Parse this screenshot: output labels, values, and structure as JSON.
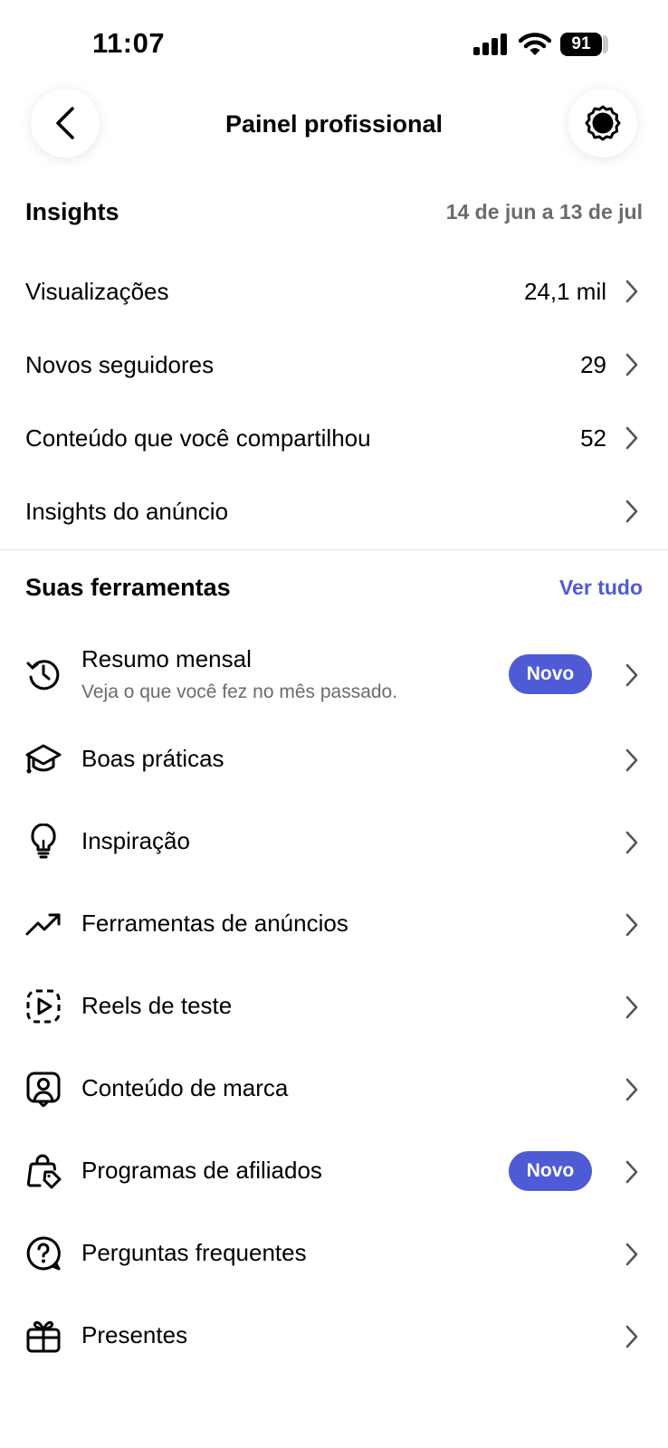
{
  "status_bar": {
    "time": "11:07",
    "battery": "91"
  },
  "header": {
    "title": "Painel profissional"
  },
  "insights": {
    "title": "Insights",
    "date_range": "14 de jun a 13 de jul",
    "rows": [
      {
        "label": "Visualizações",
        "value": "24,1 mil"
      },
      {
        "label": "Novos seguidores",
        "value": "29"
      },
      {
        "label": "Conteúdo que você compartilhou",
        "value": "52"
      },
      {
        "label": "Insights do anúncio",
        "value": ""
      }
    ]
  },
  "tools": {
    "title": "Suas ferramentas",
    "see_all": "Ver tudo",
    "items": [
      {
        "label": "Resumo mensal",
        "sub": "Veja o que você fez no mês passado.",
        "badge": "Novo",
        "icon": "history-clock-icon"
      },
      {
        "label": "Boas práticas",
        "icon": "graduation-cap-icon"
      },
      {
        "label": "Inspiração",
        "icon": "lightbulb-icon"
      },
      {
        "label": "Ferramentas de anúncios",
        "icon": "trending-up-icon"
      },
      {
        "label": "Reels de teste",
        "icon": "reels-test-icon"
      },
      {
        "label": "Conteúdo de marca",
        "icon": "branded-content-icon"
      },
      {
        "label": "Programas de afiliados",
        "badge": "Novo",
        "icon": "shopping-bag-tag-icon"
      },
      {
        "label": "Perguntas frequentes",
        "icon": "question-bubble-icon"
      },
      {
        "label": "Presentes",
        "icon": "gift-icon"
      }
    ]
  },
  "colors": {
    "accent": "#4f5bd5",
    "secondary_text": "#6b6b70"
  }
}
